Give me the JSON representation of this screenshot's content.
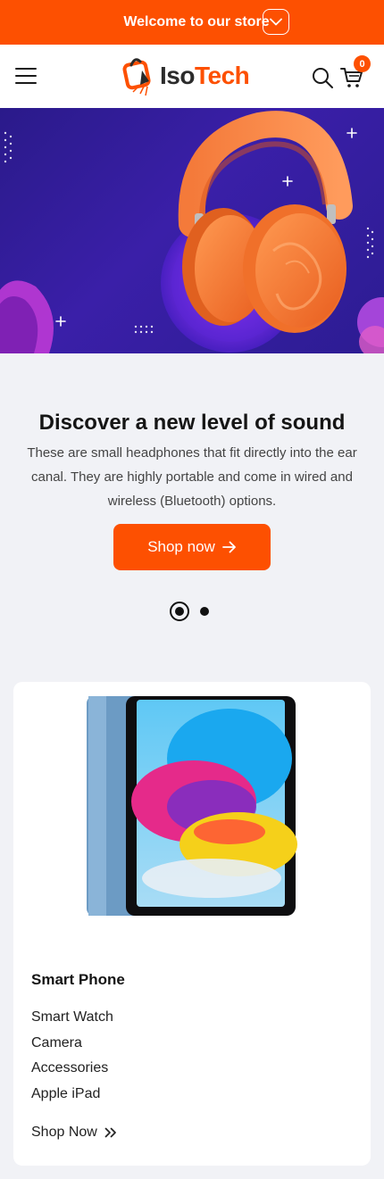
{
  "topbar": {
    "text": "Welcome to our store",
    "toggle_icon": "chevron-down-icon"
  },
  "header": {
    "menu_icon": "hamburger-icon",
    "logo": {
      "iso": "Iso",
      "tech": "Tech"
    },
    "search_icon": "search-icon",
    "cart_icon": "cart-icon",
    "cart_count": "0"
  },
  "colors": {
    "accent": "#fd5001",
    "hero_bg": "#2e1c9c",
    "page_bg": "#f1f2f6"
  },
  "hero": {
    "title": "Discover a new level of sound",
    "description": "These are small headphones that fit directly into the ear canal. They are highly portable and come in wired and wireless (Bluetooth) options.",
    "button_label": "Shop now",
    "button_icon": "arrow-right-icon",
    "slides": 2,
    "active_slide": 1
  },
  "category_card": {
    "image": "tablet-image",
    "title": "Smart Phone",
    "links": [
      "Smart Watch",
      "Camera",
      "Accessories",
      "Apple iPad"
    ],
    "shop_label": "Shop Now",
    "shop_icon": "double-chevron-right-icon"
  }
}
